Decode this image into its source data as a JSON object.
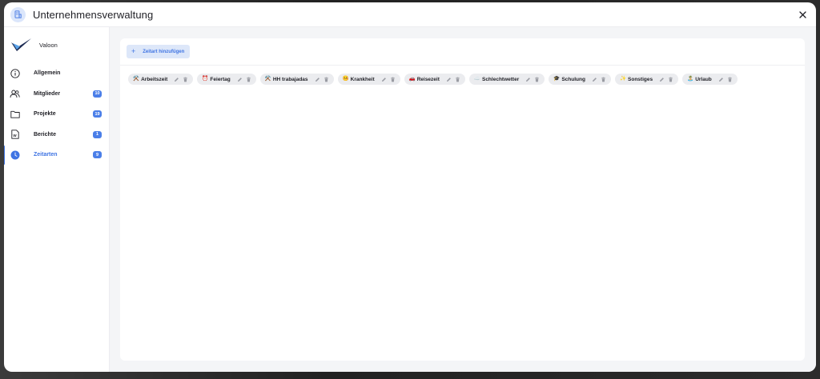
{
  "header": {
    "title": "Unternehmensverwaltung",
    "icon": "building-document-icon",
    "close_icon": "close-icon"
  },
  "brand": {
    "name": "Valoon"
  },
  "sidebar": {
    "items": [
      {
        "label": "Allgemein",
        "icon": "info-icon",
        "badge": "",
        "active": false
      },
      {
        "label": "Mitglieder",
        "icon": "users-icon",
        "badge": "10",
        "active": false
      },
      {
        "label": "Projekte",
        "icon": "folder-icon",
        "badge": "19",
        "active": false
      },
      {
        "label": "Berichte",
        "icon": "word-document-icon",
        "badge": "1",
        "active": false
      },
      {
        "label": "Zeitarten",
        "icon": "clock-icon",
        "badge": "9",
        "active": true
      }
    ]
  },
  "toolbar": {
    "add_label": "Zeitart hinzufügen"
  },
  "time_types": [
    {
      "emoji": "⚒️",
      "label": "Arbeitszeit"
    },
    {
      "emoji": "⏰",
      "label": "Feiertag"
    },
    {
      "emoji": "⚒️",
      "label": "HH trabajadas"
    },
    {
      "emoji": "🤒",
      "label": "Krankheit"
    },
    {
      "emoji": "🚗",
      "label": "Reisezeit"
    },
    {
      "emoji": "☁️",
      "label": "Schlechtwetter"
    },
    {
      "emoji": "🎓",
      "label": "Schulung"
    },
    {
      "emoji": "✨",
      "label": "Sonstiges"
    },
    {
      "emoji": "🏝️",
      "label": "Urlaub"
    }
  ],
  "colors": {
    "accent": "#3f74e3",
    "badge": "#4a7ee8",
    "chip_bg": "#ebecef"
  }
}
